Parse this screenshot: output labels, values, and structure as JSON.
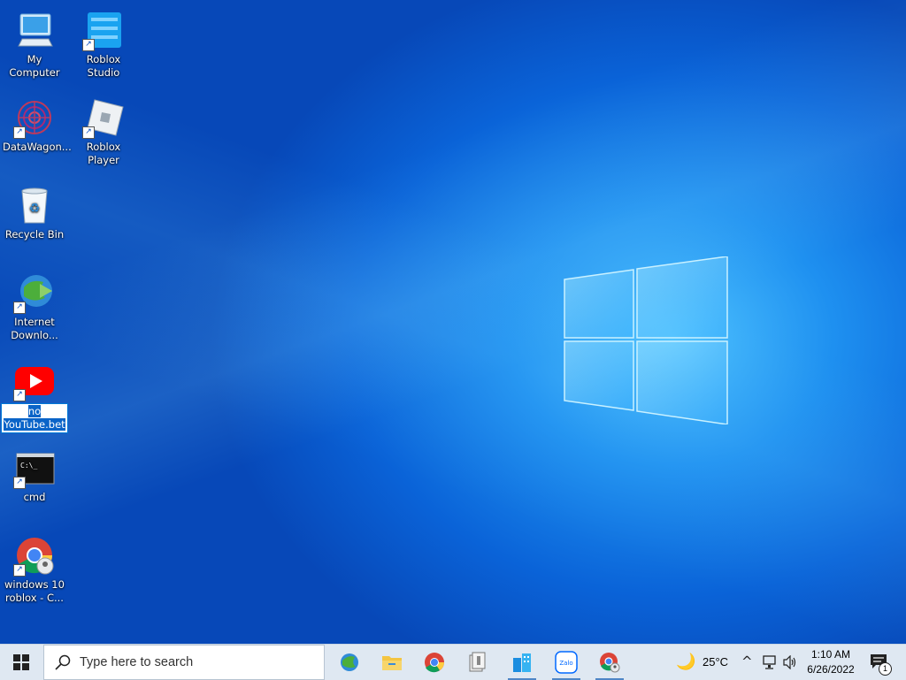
{
  "desktop": {
    "icons": [
      {
        "label": "My Computer"
      },
      {
        "label": "Roblox Studio"
      },
      {
        "label": "DataWagon..."
      },
      {
        "label": "Roblox Player"
      },
      {
        "label": "Recycle Bin"
      },
      {
        "label": "Internet Downlo..."
      },
      {
        "label_line1": "no",
        "label_line2": "YouTube.bet"
      },
      {
        "label": "cmd"
      },
      {
        "label": "windows 10 roblox - C..."
      }
    ]
  },
  "taskbar": {
    "search_placeholder": "Type here to search",
    "weather": {
      "temp": "25°C"
    },
    "clock": {
      "time": "1:10 AM",
      "date": "6/26/2022"
    },
    "notification_count": "1",
    "colors": {
      "taskbar_bg": "#dfe8f2",
      "accent": "#4f86c6",
      "selection": "#0a64c8"
    }
  }
}
